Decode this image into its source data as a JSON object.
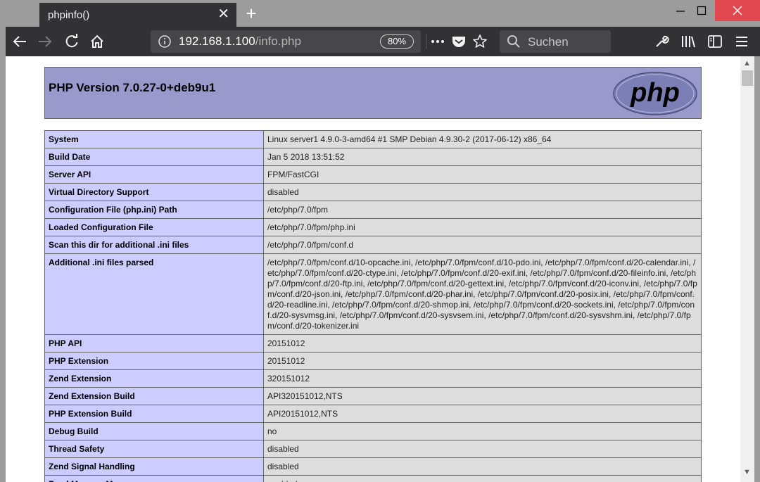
{
  "browser": {
    "tab_title": "phpinfo()",
    "tab_close": "✕",
    "new_tab": "+",
    "url_host": "192.168.1.100",
    "url_path": "/info.php",
    "zoom": "80%",
    "search_placeholder": "Suchen",
    "accent_close": "#e0474f"
  },
  "page": {
    "version_title": "PHP Version 7.0.27-0+deb9u1",
    "logo_text": "php"
  },
  "rows": [
    {
      "key": "System",
      "value": "Linux server1 4.9.0-3-amd64 #1 SMP Debian 4.9.30-2 (2017-06-12) x86_64"
    },
    {
      "key": "Build Date",
      "value": "Jan 5 2018 13:51:52"
    },
    {
      "key": "Server API",
      "value": "FPM/FastCGI"
    },
    {
      "key": "Virtual Directory Support",
      "value": "disabled"
    },
    {
      "key": "Configuration File (php.ini) Path",
      "value": "/etc/php/7.0/fpm"
    },
    {
      "key": "Loaded Configuration File",
      "value": "/etc/php/7.0/fpm/php.ini"
    },
    {
      "key": "Scan this dir for additional .ini files",
      "value": "/etc/php/7.0/fpm/conf.d"
    },
    {
      "key": "Additional .ini files parsed",
      "value": "/etc/php/7.0/fpm/conf.d/10-opcache.ini, /etc/php/7.0/fpm/conf.d/10-pdo.ini, /etc/php/7.0/fpm/conf.d/20-calendar.ini, /etc/php/7.0/fpm/conf.d/20-ctype.ini, /etc/php/7.0/fpm/conf.d/20-exif.ini, /etc/php/7.0/fpm/conf.d/20-fileinfo.ini, /etc/php/7.0/fpm/conf.d/20-ftp.ini, /etc/php/7.0/fpm/conf.d/20-gettext.ini, /etc/php/7.0/fpm/conf.d/20-iconv.ini, /etc/php/7.0/fpm/conf.d/20-json.ini, /etc/php/7.0/fpm/conf.d/20-phar.ini, /etc/php/7.0/fpm/conf.d/20-posix.ini, /etc/php/7.0/fpm/conf.d/20-readline.ini, /etc/php/7.0/fpm/conf.d/20-shmop.ini, /etc/php/7.0/fpm/conf.d/20-sockets.ini, /etc/php/7.0/fpm/conf.d/20-sysvmsg.ini, /etc/php/7.0/fpm/conf.d/20-sysvsem.ini, /etc/php/7.0/fpm/conf.d/20-sysvshm.ini, /etc/php/7.0/fpm/conf.d/20-tokenizer.ini"
    },
    {
      "key": "PHP API",
      "value": "20151012"
    },
    {
      "key": "PHP Extension",
      "value": "20151012"
    },
    {
      "key": "Zend Extension",
      "value": "320151012"
    },
    {
      "key": "Zend Extension Build",
      "value": "API320151012,NTS"
    },
    {
      "key": "PHP Extension Build",
      "value": "API20151012,NTS"
    },
    {
      "key": "Debug Build",
      "value": "no"
    },
    {
      "key": "Thread Safety",
      "value": "disabled"
    },
    {
      "key": "Zend Signal Handling",
      "value": "disabled"
    },
    {
      "key": "Zend Memory Manager",
      "value": "enabled"
    }
  ]
}
